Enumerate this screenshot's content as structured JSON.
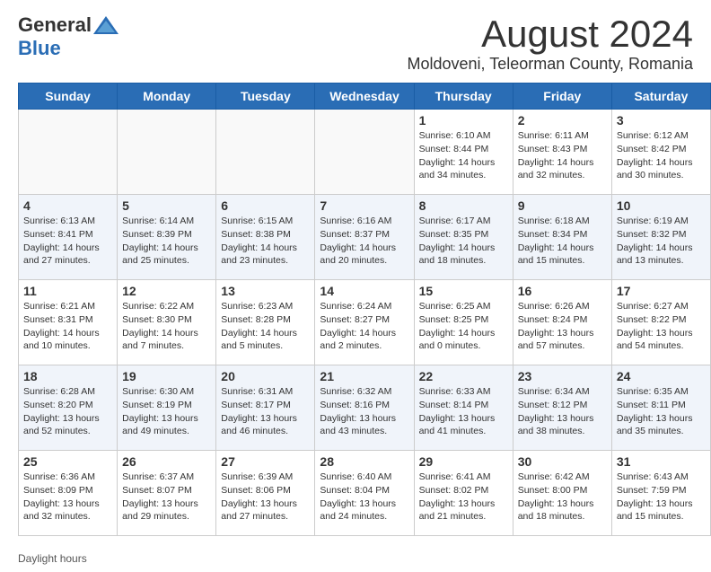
{
  "header": {
    "logo_general": "General",
    "logo_blue": "Blue",
    "main_title": "August 2024",
    "subtitle": "Moldoveni, Teleorman County, Romania"
  },
  "calendar": {
    "headers": [
      "Sunday",
      "Monday",
      "Tuesday",
      "Wednesday",
      "Thursday",
      "Friday",
      "Saturday"
    ],
    "weeks": [
      [
        {
          "day": "",
          "info": ""
        },
        {
          "day": "",
          "info": ""
        },
        {
          "day": "",
          "info": ""
        },
        {
          "day": "",
          "info": ""
        },
        {
          "day": "1",
          "info": "Sunrise: 6:10 AM\nSunset: 8:44 PM\nDaylight: 14 hours and 34 minutes."
        },
        {
          "day": "2",
          "info": "Sunrise: 6:11 AM\nSunset: 8:43 PM\nDaylight: 14 hours and 32 minutes."
        },
        {
          "day": "3",
          "info": "Sunrise: 6:12 AM\nSunset: 8:42 PM\nDaylight: 14 hours and 30 minutes."
        }
      ],
      [
        {
          "day": "4",
          "info": "Sunrise: 6:13 AM\nSunset: 8:41 PM\nDaylight: 14 hours and 27 minutes."
        },
        {
          "day": "5",
          "info": "Sunrise: 6:14 AM\nSunset: 8:39 PM\nDaylight: 14 hours and 25 minutes."
        },
        {
          "day": "6",
          "info": "Sunrise: 6:15 AM\nSunset: 8:38 PM\nDaylight: 14 hours and 23 minutes."
        },
        {
          "day": "7",
          "info": "Sunrise: 6:16 AM\nSunset: 8:37 PM\nDaylight: 14 hours and 20 minutes."
        },
        {
          "day": "8",
          "info": "Sunrise: 6:17 AM\nSunset: 8:35 PM\nDaylight: 14 hours and 18 minutes."
        },
        {
          "day": "9",
          "info": "Sunrise: 6:18 AM\nSunset: 8:34 PM\nDaylight: 14 hours and 15 minutes."
        },
        {
          "day": "10",
          "info": "Sunrise: 6:19 AM\nSunset: 8:32 PM\nDaylight: 14 hours and 13 minutes."
        }
      ],
      [
        {
          "day": "11",
          "info": "Sunrise: 6:21 AM\nSunset: 8:31 PM\nDaylight: 14 hours and 10 minutes."
        },
        {
          "day": "12",
          "info": "Sunrise: 6:22 AM\nSunset: 8:30 PM\nDaylight: 14 hours and 7 minutes."
        },
        {
          "day": "13",
          "info": "Sunrise: 6:23 AM\nSunset: 8:28 PM\nDaylight: 14 hours and 5 minutes."
        },
        {
          "day": "14",
          "info": "Sunrise: 6:24 AM\nSunset: 8:27 PM\nDaylight: 14 hours and 2 minutes."
        },
        {
          "day": "15",
          "info": "Sunrise: 6:25 AM\nSunset: 8:25 PM\nDaylight: 14 hours and 0 minutes."
        },
        {
          "day": "16",
          "info": "Sunrise: 6:26 AM\nSunset: 8:24 PM\nDaylight: 13 hours and 57 minutes."
        },
        {
          "day": "17",
          "info": "Sunrise: 6:27 AM\nSunset: 8:22 PM\nDaylight: 13 hours and 54 minutes."
        }
      ],
      [
        {
          "day": "18",
          "info": "Sunrise: 6:28 AM\nSunset: 8:20 PM\nDaylight: 13 hours and 52 minutes."
        },
        {
          "day": "19",
          "info": "Sunrise: 6:30 AM\nSunset: 8:19 PM\nDaylight: 13 hours and 49 minutes."
        },
        {
          "day": "20",
          "info": "Sunrise: 6:31 AM\nSunset: 8:17 PM\nDaylight: 13 hours and 46 minutes."
        },
        {
          "day": "21",
          "info": "Sunrise: 6:32 AM\nSunset: 8:16 PM\nDaylight: 13 hours and 43 minutes."
        },
        {
          "day": "22",
          "info": "Sunrise: 6:33 AM\nSunset: 8:14 PM\nDaylight: 13 hours and 41 minutes."
        },
        {
          "day": "23",
          "info": "Sunrise: 6:34 AM\nSunset: 8:12 PM\nDaylight: 13 hours and 38 minutes."
        },
        {
          "day": "24",
          "info": "Sunrise: 6:35 AM\nSunset: 8:11 PM\nDaylight: 13 hours and 35 minutes."
        }
      ],
      [
        {
          "day": "25",
          "info": "Sunrise: 6:36 AM\nSunset: 8:09 PM\nDaylight: 13 hours and 32 minutes."
        },
        {
          "day": "26",
          "info": "Sunrise: 6:37 AM\nSunset: 8:07 PM\nDaylight: 13 hours and 29 minutes."
        },
        {
          "day": "27",
          "info": "Sunrise: 6:39 AM\nSunset: 8:06 PM\nDaylight: 13 hours and 27 minutes."
        },
        {
          "day": "28",
          "info": "Sunrise: 6:40 AM\nSunset: 8:04 PM\nDaylight: 13 hours and 24 minutes."
        },
        {
          "day": "29",
          "info": "Sunrise: 6:41 AM\nSunset: 8:02 PM\nDaylight: 13 hours and 21 minutes."
        },
        {
          "day": "30",
          "info": "Sunrise: 6:42 AM\nSunset: 8:00 PM\nDaylight: 13 hours and 18 minutes."
        },
        {
          "day": "31",
          "info": "Sunrise: 6:43 AM\nSunset: 7:59 PM\nDaylight: 13 hours and 15 minutes."
        }
      ]
    ]
  },
  "footer": {
    "daylight_label": "Daylight hours"
  }
}
